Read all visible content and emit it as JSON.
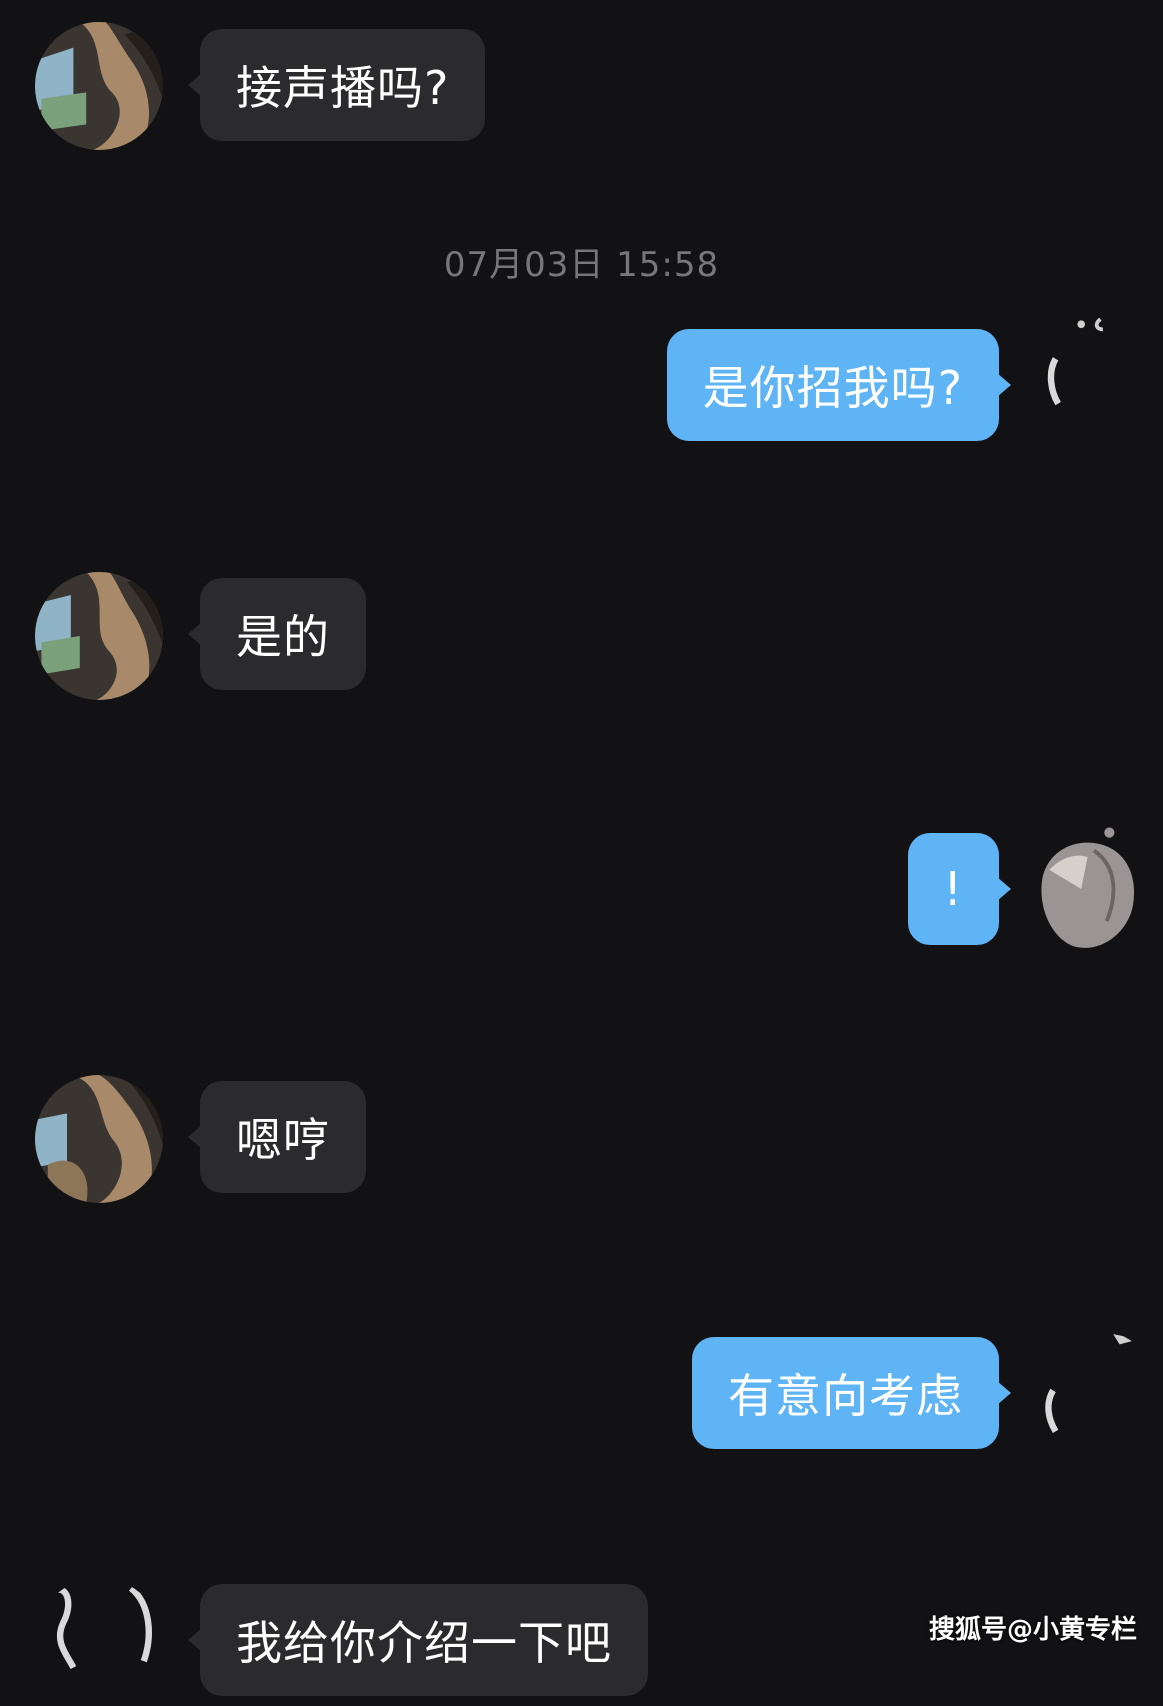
{
  "timestamp": "07月03日 15:58",
  "messages": [
    {
      "side": "incoming",
      "text": "接声播吗?"
    },
    {
      "side": "outgoing",
      "text": "是你招我吗?"
    },
    {
      "side": "incoming",
      "text": "是的"
    },
    {
      "side": "outgoing",
      "text": "!"
    },
    {
      "side": "incoming",
      "text": "嗯哼"
    },
    {
      "side": "outgoing",
      "text": "有意向考虑"
    },
    {
      "side": "incoming",
      "text": "我给你介绍一下吧"
    }
  ],
  "watermark": "搜狐号@小黄专栏",
  "colors": {
    "background": "#121214",
    "incoming_bubble": "#2b2b2d",
    "outgoing_bubble": "#5eb4f4",
    "timestamp_text": "#77777b"
  },
  "icons": {
    "incoming_avatar": "avatar-photo-icon",
    "outgoing_avatar": "avatar-photo-icon"
  }
}
